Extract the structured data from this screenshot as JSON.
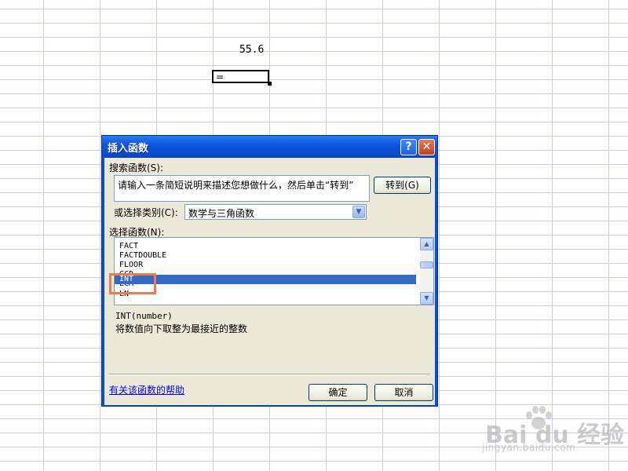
{
  "sheet": {
    "cell_value": "55.6",
    "active_cell_text": "="
  },
  "dialog": {
    "title": "插入函数",
    "help_button": "?",
    "close_button": "✕",
    "search_label": "搜索函数(S):",
    "search_placeholder": "请输入一条简短说明来描述您想做什么，然后单击“转到”",
    "go_button": "转到(G)",
    "category_label": "或选择类别(C):",
    "category_value": "数学与三角函数",
    "functions_label": "选择函数(N):",
    "functions": [
      "FACT",
      "FACTDOUBLE",
      "FLOOR",
      "GCD",
      "INT",
      "LCM",
      "LN"
    ],
    "selected_function": "INT",
    "syntax": "INT(number)",
    "description": "将数值向下取整为最接近的整数",
    "help_link": "有关该函数的帮助",
    "ok_button": "确定",
    "cancel_button": "取消"
  },
  "watermark": {
    "brand": "Bai du 经验",
    "url": "jingyan.baidu.com"
  },
  "colors": {
    "titlebar": "#0c56e0",
    "selection": "#316ac5",
    "highlight": "#f07a4a",
    "link": "#0000ff"
  }
}
